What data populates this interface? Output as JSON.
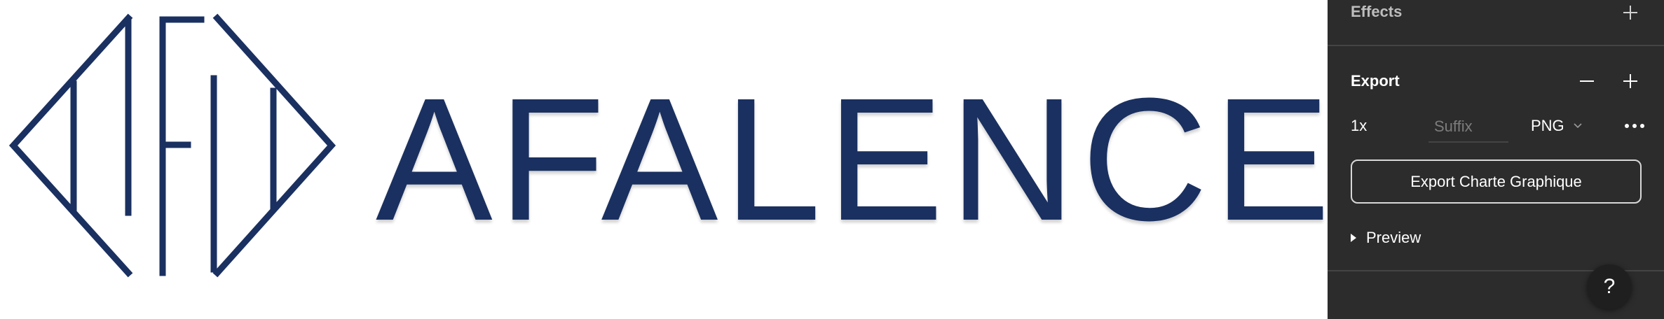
{
  "canvas": {
    "wordmark": "AFALENCE",
    "brand_color": "#1a3060"
  },
  "panel": {
    "effects": {
      "title": "Effects",
      "add_icon": "plus-icon"
    },
    "export": {
      "title": "Export",
      "remove_icon": "minus-icon",
      "add_icon": "plus-icon",
      "scale": "1x",
      "suffix_placeholder": "Suffix",
      "suffix_value": "",
      "format": "PNG",
      "format_icon": "chevron-down-icon",
      "more_icon": "ellipsis-icon",
      "button_label": "Export Charte Graphique",
      "preview_label": "Preview",
      "preview_icon": "caret-right-icon"
    },
    "help": {
      "label": "?"
    }
  },
  "colors": {
    "panel_bg": "#2c2c2c",
    "panel_divider": "#444444",
    "text": "#ffffff"
  }
}
